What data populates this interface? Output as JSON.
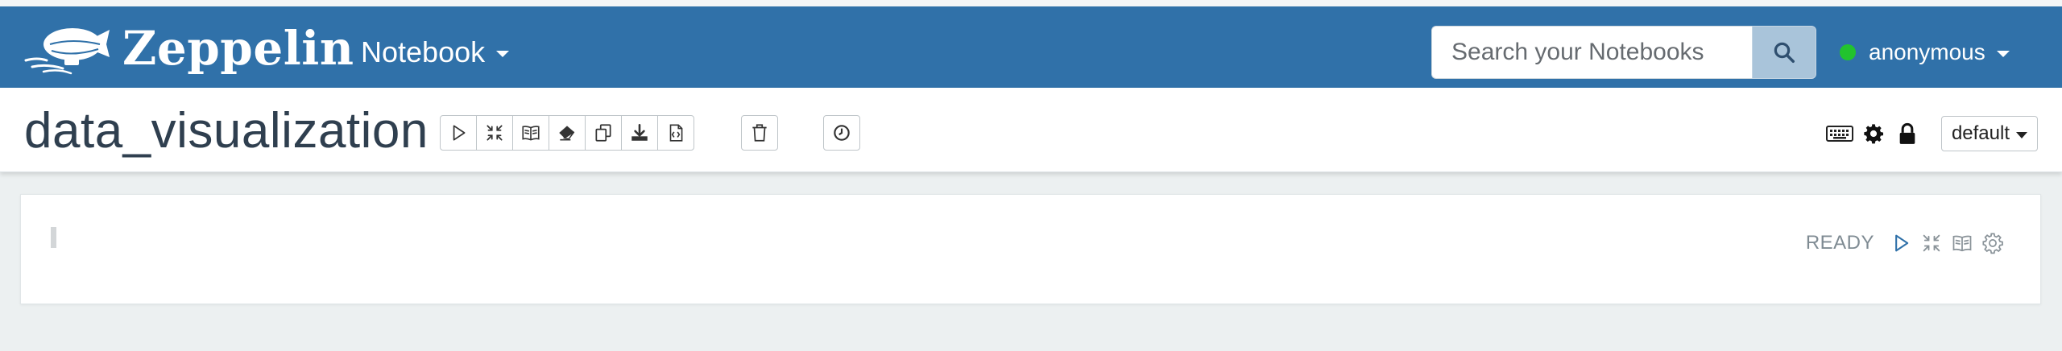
{
  "app": {
    "brand": "Zeppelin"
  },
  "navbar": {
    "menu_label": "Notebook",
    "search": {
      "placeholder": "Search your Notebooks",
      "value": ""
    },
    "user": {
      "name": "anonymous",
      "status_color": "#22c32e"
    }
  },
  "notebook": {
    "title": "data_visualization",
    "toolbar": {
      "group1": [
        "run-all-icon",
        "collapse-icon",
        "book-open-icon",
        "eraser-icon",
        "clone-icon",
        "download-icon",
        "export-file-icon"
      ],
      "delete": "trash-icon",
      "schedule": "clock-icon"
    },
    "right_tools": {
      "icons": [
        "keyboard-icon",
        "gear-icon",
        "lock-icon"
      ],
      "interpreter_label": "default"
    }
  },
  "paragraph": {
    "status": "READY",
    "controls": [
      "run-icon",
      "collapse-icon",
      "book-open-icon",
      "gear-icon"
    ]
  },
  "colors": {
    "navbar": "#3071a9",
    "search_button": "#a9c4da",
    "title_text": "#2f3f4f",
    "background": "#ecf0f1"
  }
}
